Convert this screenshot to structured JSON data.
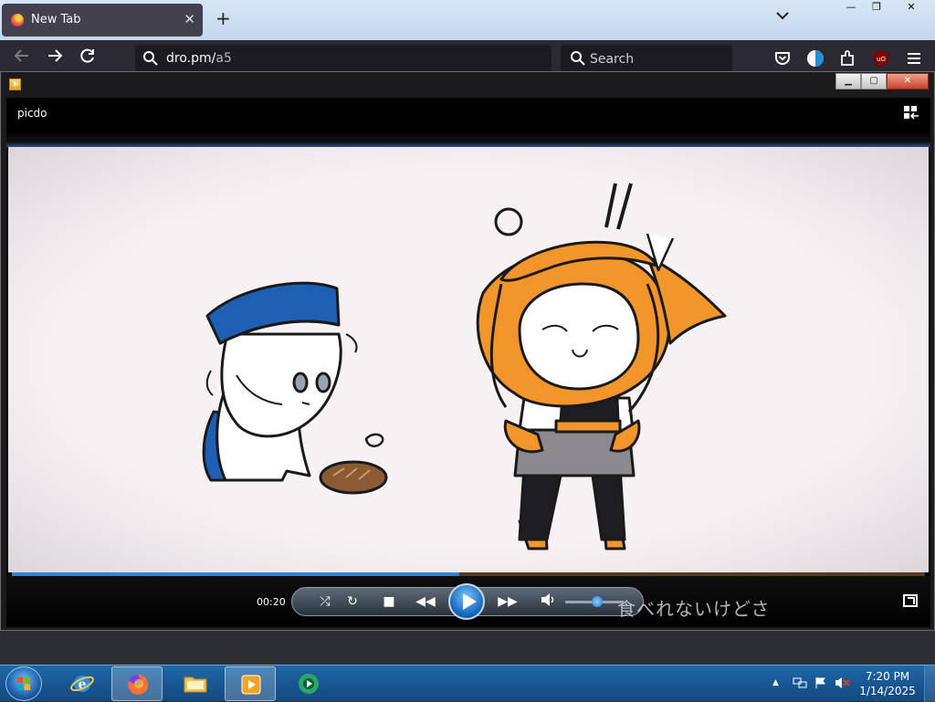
{
  "browser": {
    "tab_title": "New Tab",
    "tab_close": "✕",
    "new_tab": "+",
    "url_host": "dro.pm/",
    "url_path": "a5",
    "search_placeholder": "Search"
  },
  "player_window": {
    "player_title": "picdo",
    "elapsed_time": "00:20",
    "subtitle_text": "食べれないけどさ",
    "progress_fraction": 0.49,
    "volume_fraction": 0.55
  },
  "taskbar": {
    "time": "7:20 PM",
    "date": "1/14/2025"
  },
  "colors": {
    "browser_toolbar": "#2b2a33",
    "seek_played": "#2f86d8",
    "taskbar": "#1a5a98",
    "character_orange": "#f2952a",
    "beret_blue": "#1e5fb4"
  },
  "icons": [
    "firefox-icon",
    "back-arrow-icon",
    "forward-arrow-icon",
    "reload-icon",
    "search-icon",
    "pocket-icon",
    "container-icon",
    "extensions-icon",
    "ublock-icon",
    "menu-icon",
    "start-orb-icon",
    "ie-icon",
    "explorer-folder-icon",
    "media-player-icon",
    "wmc-icon"
  ]
}
